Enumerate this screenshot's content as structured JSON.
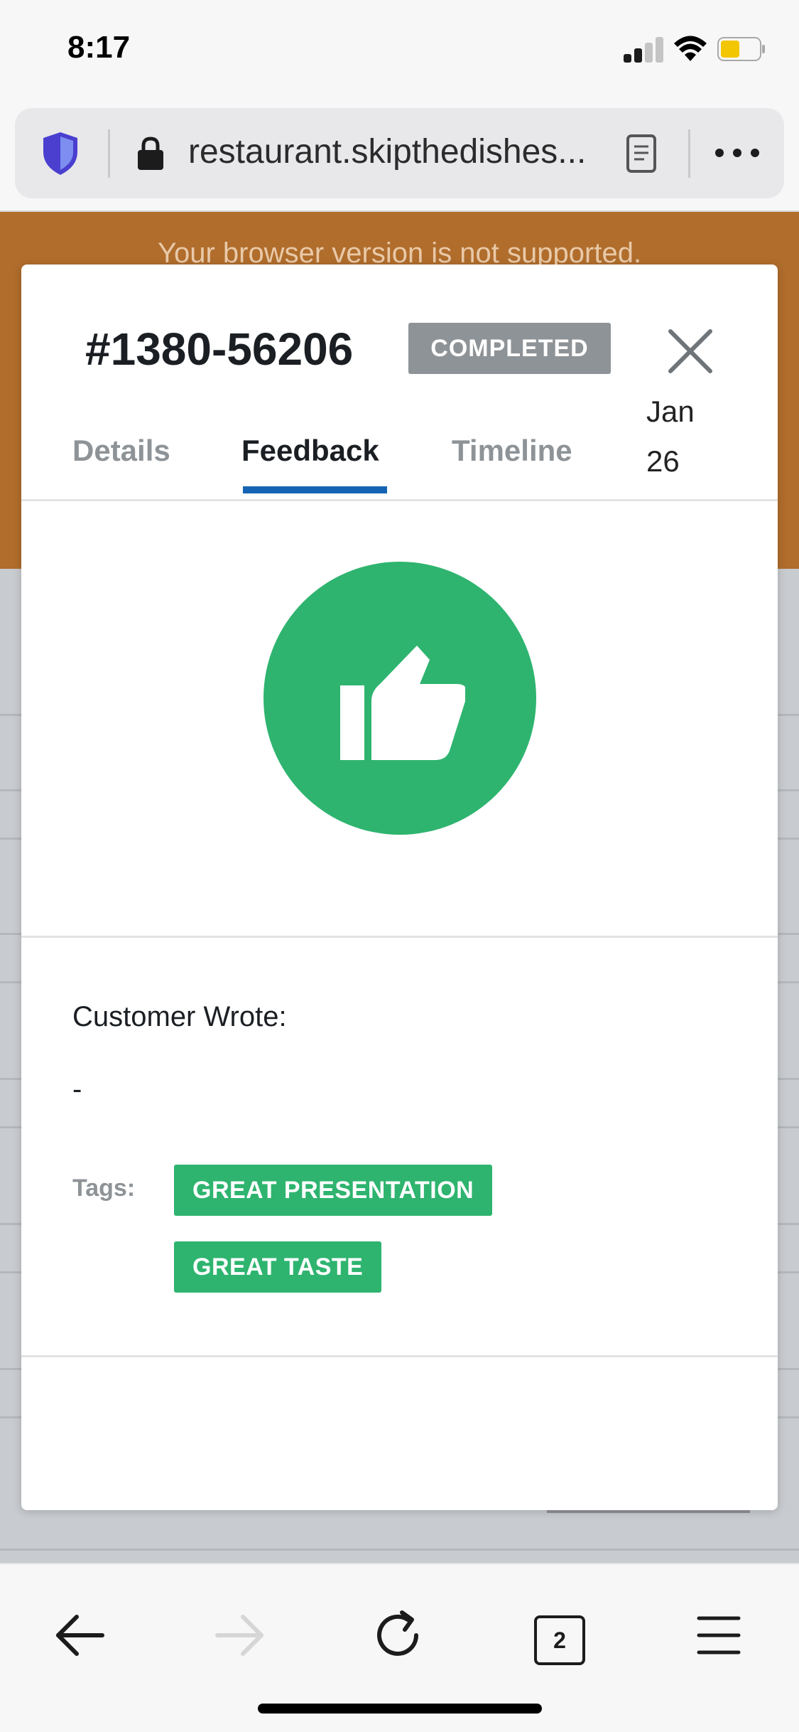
{
  "status_bar": {
    "time": "8:17"
  },
  "url_bar": {
    "url": "restaurant.skipthedishes..."
  },
  "background": {
    "banner_text": "Your browser version is not supported."
  },
  "order": {
    "number": "#1380-56206",
    "status": "COMPLETED",
    "date_month": "Jan",
    "date_day": "26"
  },
  "tabs": [
    {
      "label": "Details",
      "active": false
    },
    {
      "label": "Feedback",
      "active": true
    },
    {
      "label": "Timeline",
      "active": false
    }
  ],
  "feedback": {
    "rating_icon": "thumbs-up-icon",
    "rating": "positive",
    "customer_label": "Customer Wrote:",
    "customer_text": "-",
    "tags_label": "Tags:",
    "tags": [
      "GREAT PRESENTATION",
      "GREAT TASTE"
    ]
  },
  "browser_toolbar": {
    "tab_count": "2"
  },
  "colors": {
    "accent_green": "#2eb46f",
    "tab_underline": "#1564b3",
    "badge_gray": "#8e9397",
    "banner_orange": "#b06d2c"
  }
}
